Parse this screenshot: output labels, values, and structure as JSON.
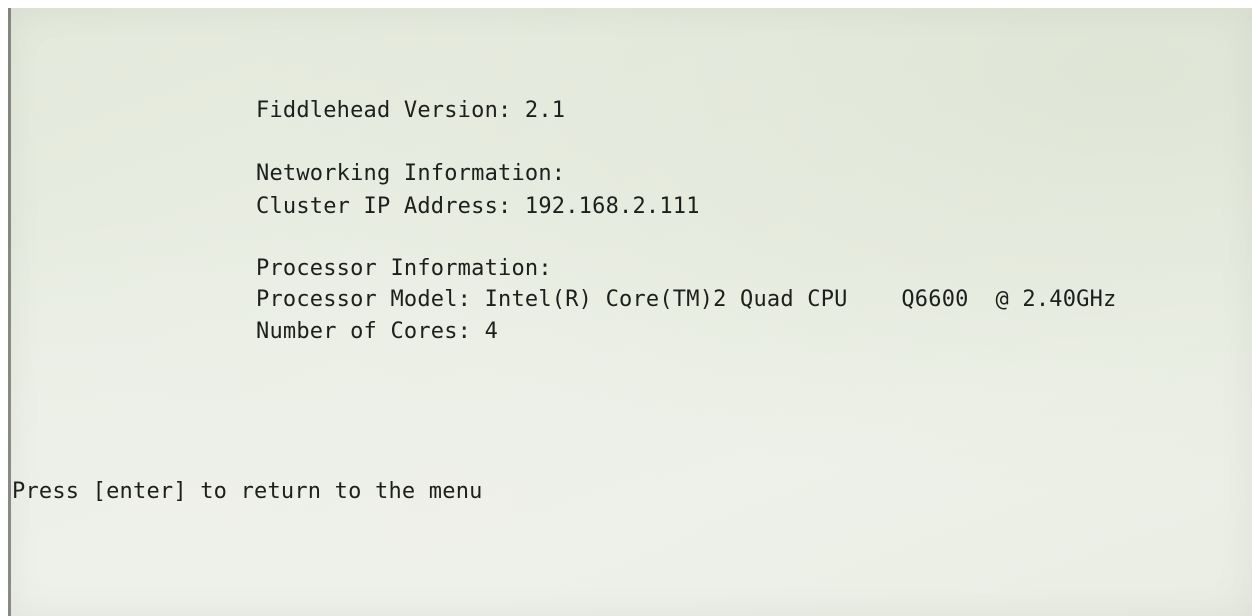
{
  "console": {
    "version_line": "Fiddlehead Version: 2.1",
    "networking_header": "Networking Information:",
    "cluster_ip_line": "Cluster IP Address: 192.168.2.111",
    "processor_header": "Processor Information:",
    "processor_model_line": "Processor Model: Intel(R) Core(TM)2 Quad CPU    Q6600  @ 2.40GHz",
    "cores_line": "Number of Cores: 4",
    "prompt_line": "Press [enter] to return to the menu"
  },
  "colors": {
    "screen_background": "#e8ede2",
    "text": "#1e1f1c"
  }
}
